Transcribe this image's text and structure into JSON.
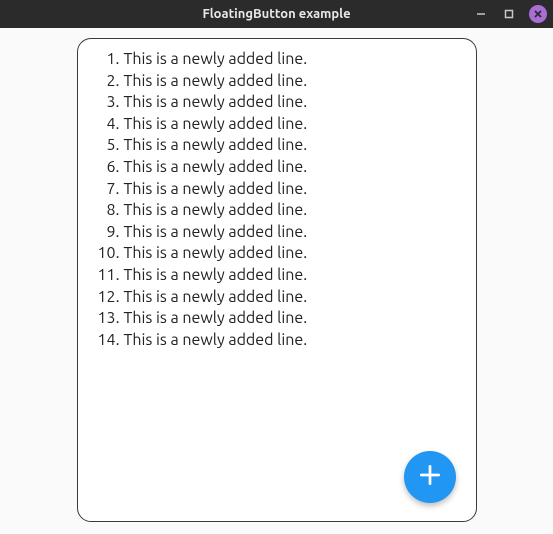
{
  "window": {
    "title": "FloatingButton example"
  },
  "lines": [
    {
      "n": "1.",
      "text": "This is a newly added line."
    },
    {
      "n": "2.",
      "text": "This is a newly added line."
    },
    {
      "n": "3.",
      "text": "This is a newly added line."
    },
    {
      "n": "4.",
      "text": "This is a newly added line."
    },
    {
      "n": "5.",
      "text": "This is a newly added line."
    },
    {
      "n": "6.",
      "text": "This is a newly added line."
    },
    {
      "n": "7.",
      "text": "This is a newly added line."
    },
    {
      "n": "8.",
      "text": "This is a newly added line."
    },
    {
      "n": "9.",
      "text": "This is a newly added line."
    },
    {
      "n": "10.",
      "text": "This is a newly added line."
    },
    {
      "n": "11.",
      "text": "This is a newly added line."
    },
    {
      "n": "12.",
      "text": "This is a newly added line."
    },
    {
      "n": "13.",
      "text": "This is a newly added line."
    },
    {
      "n": "14.",
      "text": "This is a newly added line."
    }
  ],
  "fab": {
    "icon_name": "plus-icon"
  }
}
